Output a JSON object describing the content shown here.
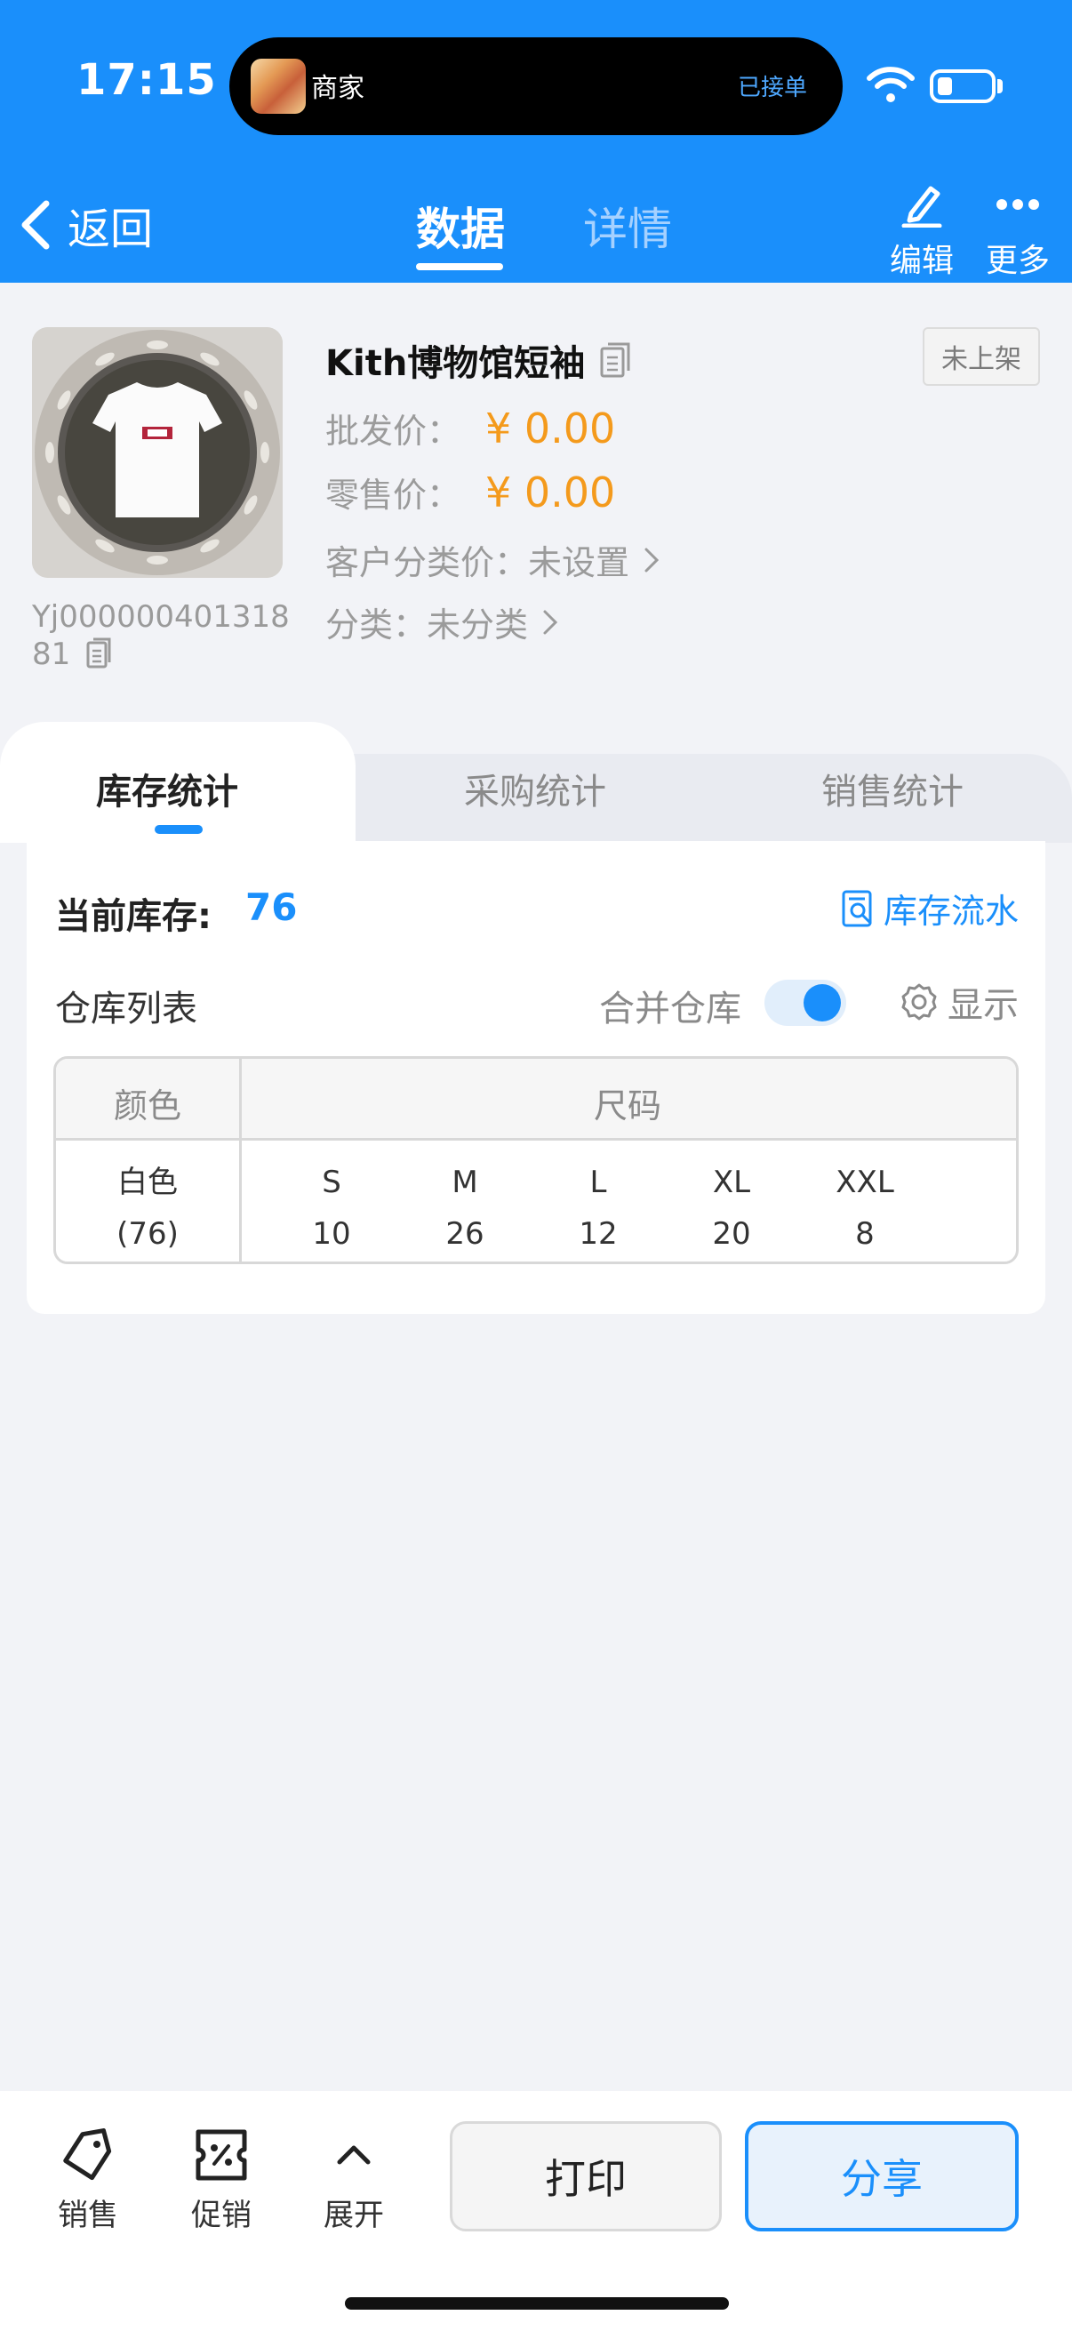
{
  "status_bar": {
    "time": "17:15",
    "island_title": "商家",
    "island_status": "已接单"
  },
  "nav": {
    "back_label": "返回",
    "tabs": [
      "数据",
      "详情"
    ],
    "active_tab": "数据",
    "edit_label": "编辑",
    "more_label": "更多"
  },
  "product": {
    "name": "Kith博物馆短袖",
    "sku": "Yj00000040131881",
    "status_badge": "未上架",
    "wholesale_label": "批发价：",
    "wholesale_price": "¥ 0.00",
    "retail_label": "零售价：",
    "retail_price": "¥ 0.00",
    "customer_price_label": "客户分类价：",
    "customer_price_value": "未设置",
    "category_label": "分类：",
    "category_value": "未分类"
  },
  "stats_tabs": [
    "库存统计",
    "采购统计",
    "销售统计"
  ],
  "inventory": {
    "current_label": "当前库存:",
    "current_value": "76",
    "flow_label": "库存流水",
    "warehouse_list_label": "仓库列表",
    "merge_label": "合并仓库",
    "merge_enabled": true,
    "show_label": "显示",
    "table": {
      "color_header": "颜色",
      "size_header": "尺码",
      "color": "白色",
      "color_total": "(76)",
      "sizes": [
        "S",
        "M",
        "L",
        "XL",
        "XXL"
      ],
      "quantities": [
        "10",
        "26",
        "12",
        "20",
        "8"
      ]
    }
  },
  "bottom_bar": {
    "sale_label": "销售",
    "promo_label": "促销",
    "expand_label": "展开",
    "print_label": "打印",
    "share_label": "分享"
  },
  "colors": {
    "brand_blue": "#1a8ffb",
    "price_orange": "#f49a1c"
  }
}
